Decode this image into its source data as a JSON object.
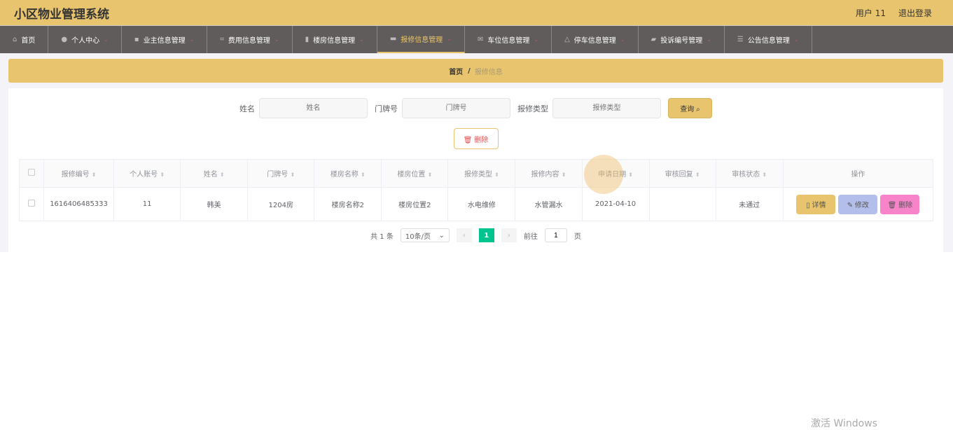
{
  "header": {
    "title": "小区物业管理系统",
    "user": "用户 11",
    "logout": "退出登录"
  },
  "nav": [
    {
      "label": "首页",
      "icon": "home-icon"
    },
    {
      "label": "个人中心",
      "icon": "user-icon"
    },
    {
      "label": "业主信息管理",
      "icon": "wallet-icon"
    },
    {
      "label": "费用信息管理",
      "icon": "crop-icon"
    },
    {
      "label": "楼房信息管理",
      "icon": "building-icon"
    },
    {
      "label": "报修信息管理",
      "icon": "message-icon"
    },
    {
      "label": "车位信息管理",
      "icon": "mail-icon"
    },
    {
      "label": "停车信息管理",
      "icon": "bell-icon"
    },
    {
      "label": "投诉编号管理",
      "icon": "briefcase-icon"
    },
    {
      "label": "公告信息管理",
      "icon": "sliders-icon"
    }
  ],
  "breadcrumb": {
    "home": "首页",
    "sep": "/",
    "current": "报修信息"
  },
  "search": {
    "name_label": "姓名",
    "name_ph": "姓名",
    "door_label": "门牌号",
    "door_ph": "门牌号",
    "type_label": "报修类型",
    "type_ph": "报修类型",
    "query": "查询 ⌕"
  },
  "delete_label": "🗑 删除",
  "table": {
    "headers": [
      "报修编号",
      "个人账号",
      "姓名",
      "门牌号",
      "楼房名称",
      "楼房位置",
      "报修类型",
      "报修内容",
      "申请日期",
      "审核回复",
      "审核状态",
      "操作"
    ],
    "rows": [
      [
        "1616406485333",
        "11",
        "韩美",
        "1204房",
        "楼房名称2",
        "楼房位置2",
        "水电维修",
        "水管漏水",
        "2021-04-10",
        "",
        "未通过"
      ]
    ],
    "actions": {
      "detail": "▯ 详情",
      "edit": "✎ 修改",
      "delete": "🗑 删除"
    }
  },
  "pagination": {
    "total": "共 1 条",
    "page_size": "10条/页",
    "current": "1",
    "goto": "前往",
    "goto_value": "1",
    "page_unit": "页"
  },
  "watermark": "激活 Windows"
}
